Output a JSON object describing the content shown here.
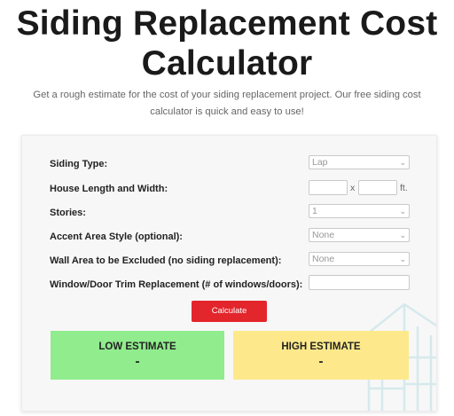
{
  "header": {
    "title": "Siding Replacement Cost Calculator",
    "subtitle": "Get a rough estimate for the cost of your siding replacement project. Our free siding cost calculator is quick and easy to use!"
  },
  "form": {
    "siding_type": {
      "label": "Siding Type:",
      "value": "Lap"
    },
    "house_dims": {
      "label": "House Length and Width:",
      "separator": "x",
      "unit": "ft."
    },
    "stories": {
      "label": "Stories:",
      "value": "1"
    },
    "accent_style": {
      "label": "Accent Area Style (optional):",
      "value": "None"
    },
    "wall_excluded": {
      "label": "Wall Area to be Excluded (no siding replacement):",
      "value": "None"
    },
    "trim": {
      "label": "Window/Door Trim Replacement (# of windows/doors):"
    },
    "calculate_label": "Calculate"
  },
  "results": {
    "low": {
      "label": "LOW ESTIMATE",
      "value": "-"
    },
    "high": {
      "label": "HIGH ESTIMATE",
      "value": "-"
    }
  },
  "colors": {
    "accent": "#e3252c",
    "low_bg": "#90ec8d",
    "high_bg": "#fde98c"
  },
  "icons": {
    "select_arrow": "chevron-down-icon",
    "decoration": "house-outline-icon"
  }
}
